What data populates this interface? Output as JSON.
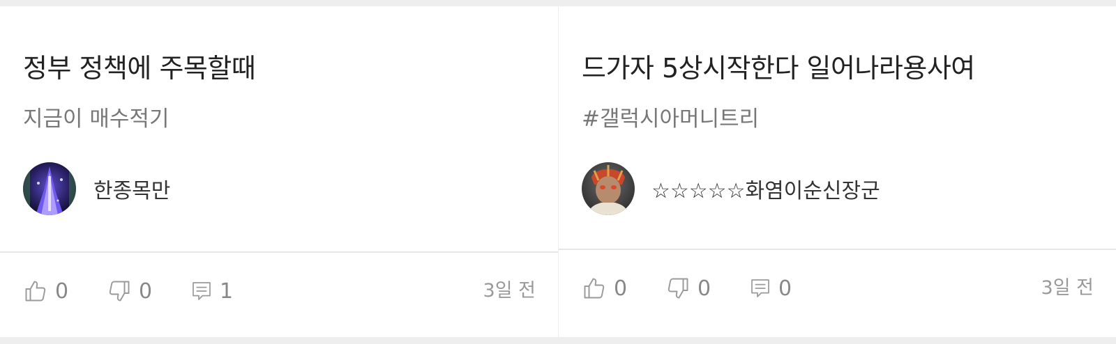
{
  "posts": [
    {
      "title": "정부 정책에 주목할때",
      "subtitle": "지금이 매수적기",
      "author": {
        "name": "한종목만",
        "avatar_icon": "avatar-purple-tower"
      },
      "likes": "0",
      "dislikes": "0",
      "comments": "1",
      "time": "3일 전"
    },
    {
      "title": "드가자 5상시작한다 일어나라용사여",
      "subtitle": "#갤럭시아머니트리",
      "author": {
        "name": "☆☆☆☆☆화염이순신장군",
        "avatar_icon": "avatar-warrior-face"
      },
      "likes": "0",
      "dislikes": "0",
      "comments": "0",
      "time": "3일 전"
    }
  ],
  "icons": {
    "like": "thumbs-up-icon",
    "dislike": "thumbs-down-icon",
    "comment": "comment-icon"
  },
  "colors": {
    "background": "#eeeeee",
    "card": "#ffffff",
    "icon": "#999999"
  }
}
